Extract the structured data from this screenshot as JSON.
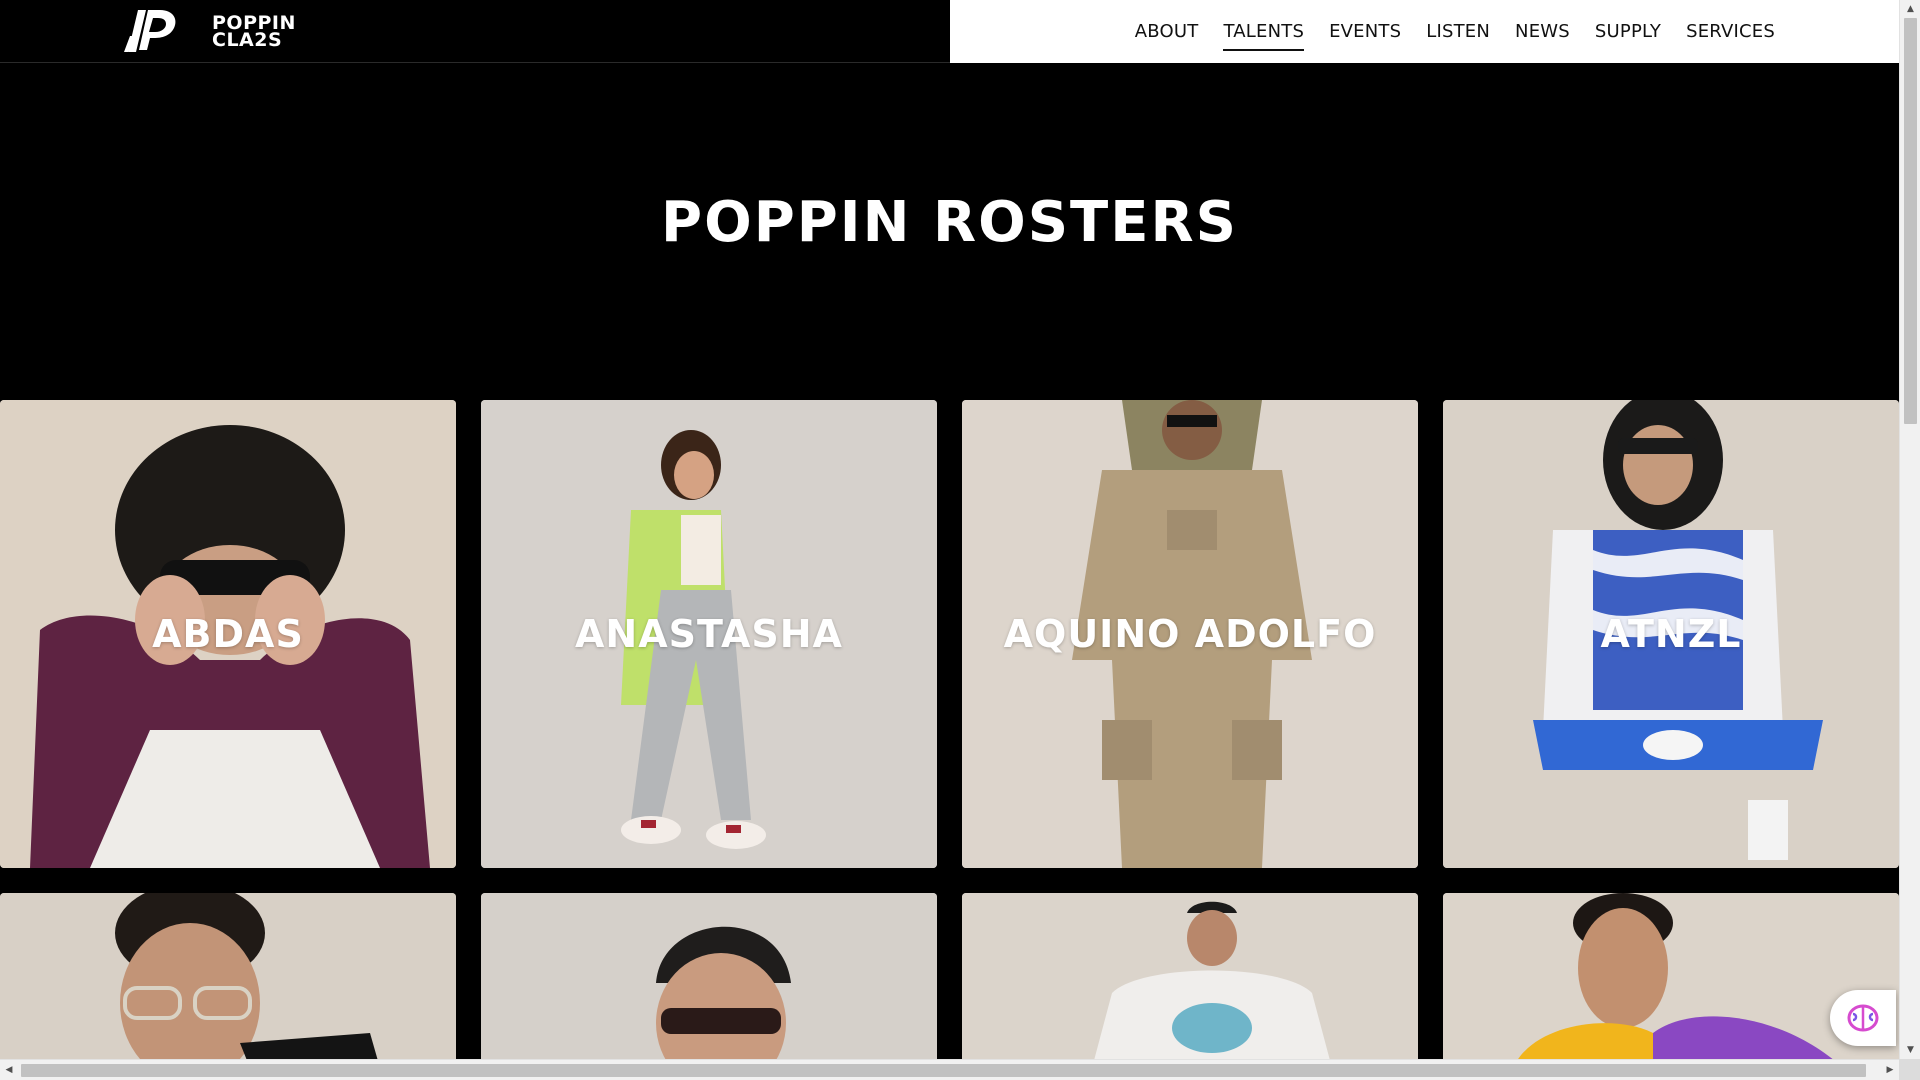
{
  "brand": {
    "line1": "POPPIN",
    "line2": "CLA2S"
  },
  "nav": {
    "items": [
      {
        "label": "ABOUT",
        "active": false
      },
      {
        "label": "TALENTS",
        "active": true
      },
      {
        "label": "EVENTS",
        "active": false
      },
      {
        "label": "LISTEN",
        "active": false
      },
      {
        "label": "NEWS",
        "active": false
      },
      {
        "label": "SUPPLY",
        "active": false
      },
      {
        "label": "SERVICES",
        "active": false
      }
    ]
  },
  "hero": {
    "title": "POPPIN ROSTERS"
  },
  "roster": {
    "row1": [
      {
        "name": "ABDAS"
      },
      {
        "name": "ANASTASHA"
      },
      {
        "name": "AQUINO ADOLFO"
      },
      {
        "name": "ATNZL"
      }
    ],
    "row2": [
      {
        "name": ""
      },
      {
        "name": ""
      },
      {
        "name": ""
      },
      {
        "name": ""
      }
    ]
  },
  "colors": {
    "background": "#000000",
    "header_right": "#ffffff",
    "card_bg": "#ddd6cd"
  },
  "icons": {
    "widget": "brain-icon"
  }
}
